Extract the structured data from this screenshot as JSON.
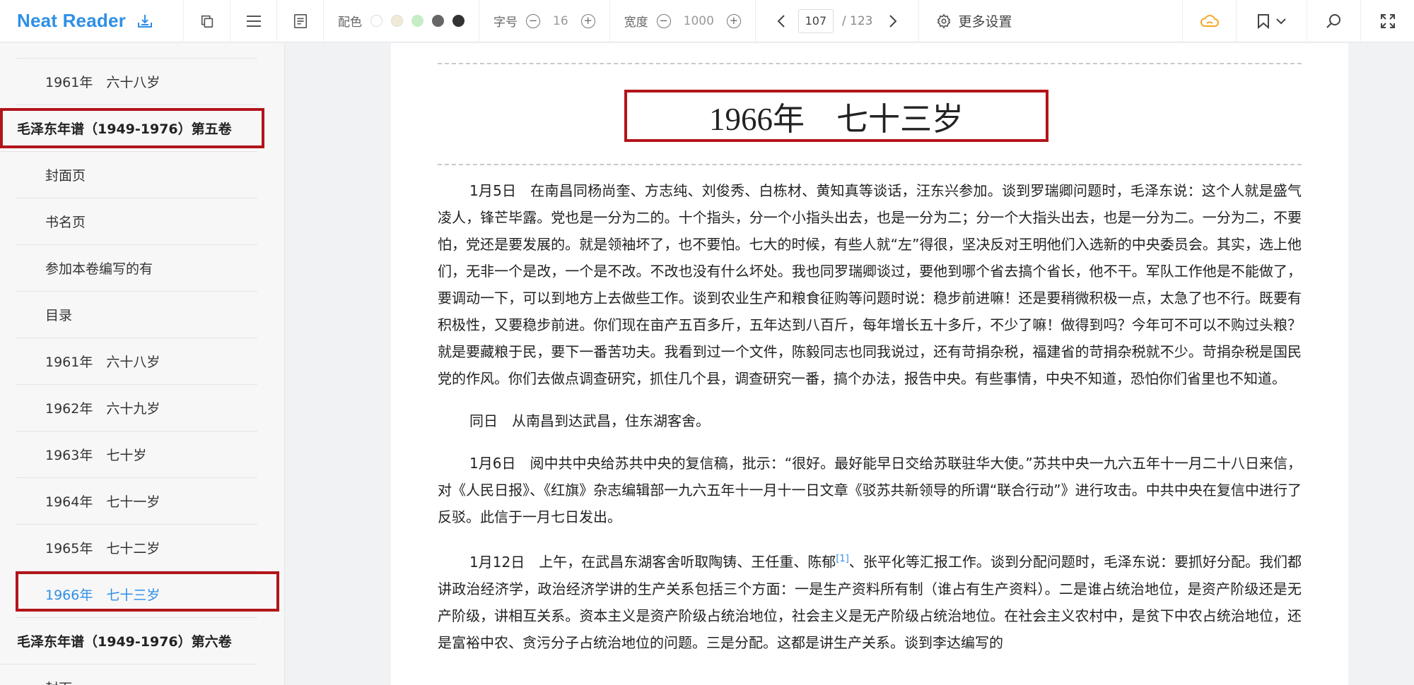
{
  "app": {
    "name": "Neat Reader"
  },
  "toolbar": {
    "color_label": "配色",
    "theme_colors": [
      "#ffffff",
      "#f1ead6",
      "#c7ecc5",
      "#666666",
      "#333333"
    ],
    "font_size_label": "字号",
    "font_size_value": "16",
    "width_label": "宽度",
    "width_value": "1000",
    "current_page": "107",
    "total_pages": "/ 123",
    "more_settings": "更多设置",
    "accent_color": "#2e8fe6",
    "cloud_color": "#f5a623"
  },
  "sidebar": {
    "items": [
      {
        "label": "1961年　六十八岁",
        "type": "child"
      },
      {
        "label": "毛泽东年谱（1949-1976）第五卷",
        "type": "volume"
      },
      {
        "label": "封面页",
        "type": "child"
      },
      {
        "label": "书名页",
        "type": "child"
      },
      {
        "label": "参加本卷编写的有",
        "type": "child"
      },
      {
        "label": "目录",
        "type": "child"
      },
      {
        "label": "1961年　六十八岁",
        "type": "child"
      },
      {
        "label": "1962年　六十九岁",
        "type": "child"
      },
      {
        "label": "1963年　七十岁",
        "type": "child"
      },
      {
        "label": "1964年　七十一岁",
        "type": "child"
      },
      {
        "label": "1965年　七十二岁",
        "type": "child"
      },
      {
        "label": "1966年　七十三岁",
        "type": "child",
        "active": true
      },
      {
        "label": "毛泽东年谱（1949-1976）第六卷",
        "type": "volume"
      },
      {
        "label": "封面",
        "type": "child"
      }
    ]
  },
  "reader": {
    "chapter_title": "1966年　七十三岁",
    "paragraphs": [
      {
        "date": "1月5日",
        "text": "在南昌同杨尚奎、方志纯、刘俊秀、白栋材、黄知真等谈话，汪东兴参加。谈到罗瑞卿问题时，毛泽东说：这个人就是盛气凌人，锋芒毕露。党也是一分为二的。十个指头，分一个小指头出去，也是一分为二；分一个大指头出去，也是一分为二。一分为二，不要怕，党还是要发展的。就是领袖坏了，也不要怕。七大的时候，有些人就“左”得很，坚决反对王明他们入选新的中央委员会。其实，选上他们，无非一个是改，一个是不改。不改也没有什么坏处。我也同罗瑞卿谈过，要他到哪个省去搞个省长，他不干。军队工作他是不能做了，要调动一下，可以到地方上去做些工作。谈到农业生产和粮食征购等问题时说：稳步前进嘛！还是要稍微积极一点，太急了也不行。既要有积极性，又要稳步前进。你们现在亩产五百多斤，五年达到八百斤，每年增长五十多斤，不少了嘛！做得到吗？今年可不可以不购过头粮？就是要藏粮于民，要下一番苦功夫。我看到过一个文件，陈毅同志也同我说过，还有苛捐杂税，福建省的苛捐杂税就不少。苛捐杂税是国民党的作风。你们去做点调查研究，抓住几个县，调查研究一番，搞个办法，报告中央。有些事情，中央不知道，恐怕你们省里也不知道。"
      },
      {
        "date": "同日",
        "text": "从南昌到达武昌，住东湖客舍。"
      },
      {
        "date": "1月6日",
        "text": "阅中共中央给苏共中央的复信稿，批示：“很好。最好能早日交给苏联驻华大使。”苏共中央一九六五年十一月二十八日来信，对《人民日报》、《红旗》杂志编辑部一九六五年十一月十一日文章《驳苏共新领导的所谓“联合行动”》进行攻击。中共中央在复信中进行了反驳。此信于一月七日发出。"
      },
      {
        "date": "1月12日",
        "text_before_note": "上午，在武昌东湖客舍听取陶铸、王任重、陈郁",
        "note": "[1]",
        "text": "、张平化等汇报工作。谈到分配问题时，毛泽东说：要抓好分配。我们都讲政治经济学，政治经济学讲的生产关系包括三个方面：一是生产资料所有制（谁占有生产资料）。二是谁占统治地位，是资产阶级还是无产阶级，讲相互关系。资本主义是资产阶级占统治地位，社会主义是无产阶级占统治地位。在社会主义农村中，是贫下中农占统治地位，还是富裕中农、贪污分子占统治地位的问题。三是分配。这都是讲生产关系。谈到李达编写的"
      }
    ]
  }
}
